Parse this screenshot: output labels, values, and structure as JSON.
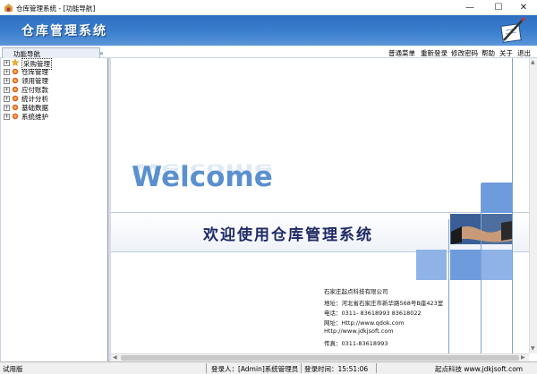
{
  "window": {
    "title": "仓库管理系统 - [功能导航]",
    "minimize": "—",
    "maximize": "☐",
    "close": "✕"
  },
  "banner": {
    "title": "仓库管理系统"
  },
  "tab": {
    "label": "功能导航",
    "pin": "«"
  },
  "menu": {
    "items": [
      "普通菜单",
      "重新登录",
      "修改密码",
      "帮助",
      "关于",
      "退出"
    ]
  },
  "tree": {
    "items": [
      {
        "label": "采购管理",
        "icon": "star-folder-icon"
      },
      {
        "label": "仓库管理",
        "icon": "folder-icon"
      },
      {
        "label": "领用管理",
        "icon": "folder-icon"
      },
      {
        "label": "应付账款",
        "icon": "folder-icon"
      },
      {
        "label": "统计分析",
        "icon": "folder-icon"
      },
      {
        "label": "基础数据",
        "icon": "folder-icon"
      },
      {
        "label": "系统维护",
        "icon": "folder-icon"
      }
    ]
  },
  "main": {
    "welcome": "Welcome",
    "slogan": "欢迎使用仓库管理系统",
    "contact": [
      "石家庄起点科技有限公司",
      "地址：河北省石家庄市新华路568号B座423室",
      "电话：0311- 83618993  83618022",
      "网址：Http://www.qdok.com",
      "      Http://www.jdkjsoft.com",
      "传真：0311-83618993"
    ]
  },
  "status": {
    "mode": "试用版",
    "login": "登录人：[Admin]系统管理员",
    "login_time": "登录时间：15:51:06",
    "company": "起点科技 www.jdkjsoft.com"
  },
  "colors": {
    "banner": "#3b7fcf",
    "accent": "#6e9bdc",
    "welcome": "#5b90cf",
    "slogan": "#1f2a66"
  }
}
